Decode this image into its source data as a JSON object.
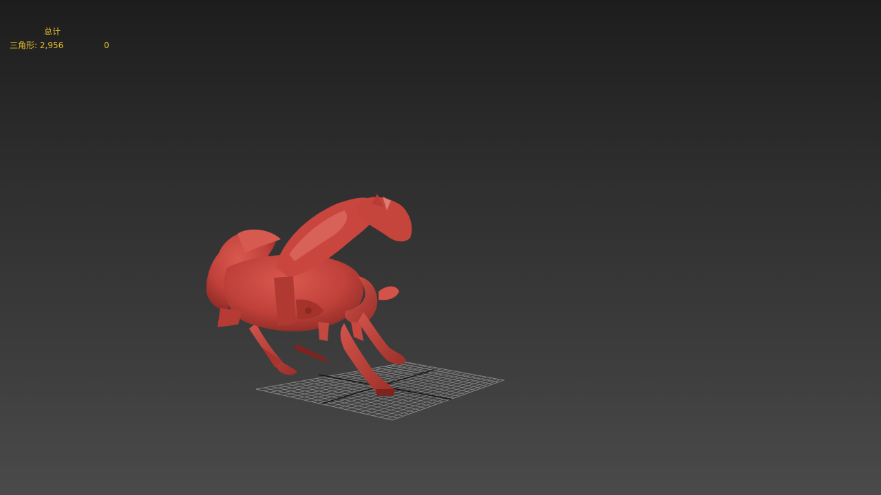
{
  "viewport": {
    "background_top": "#1d1d1d",
    "background_bottom": "#4a4a4a",
    "model_color": "#c4443c",
    "grid_color": "#9a9a9a"
  },
  "stats": {
    "header": "总计",
    "triangles_label": "三角形:",
    "triangles_total": "2,956",
    "triangles_selected": "0",
    "text_color": "#e6c12e"
  }
}
